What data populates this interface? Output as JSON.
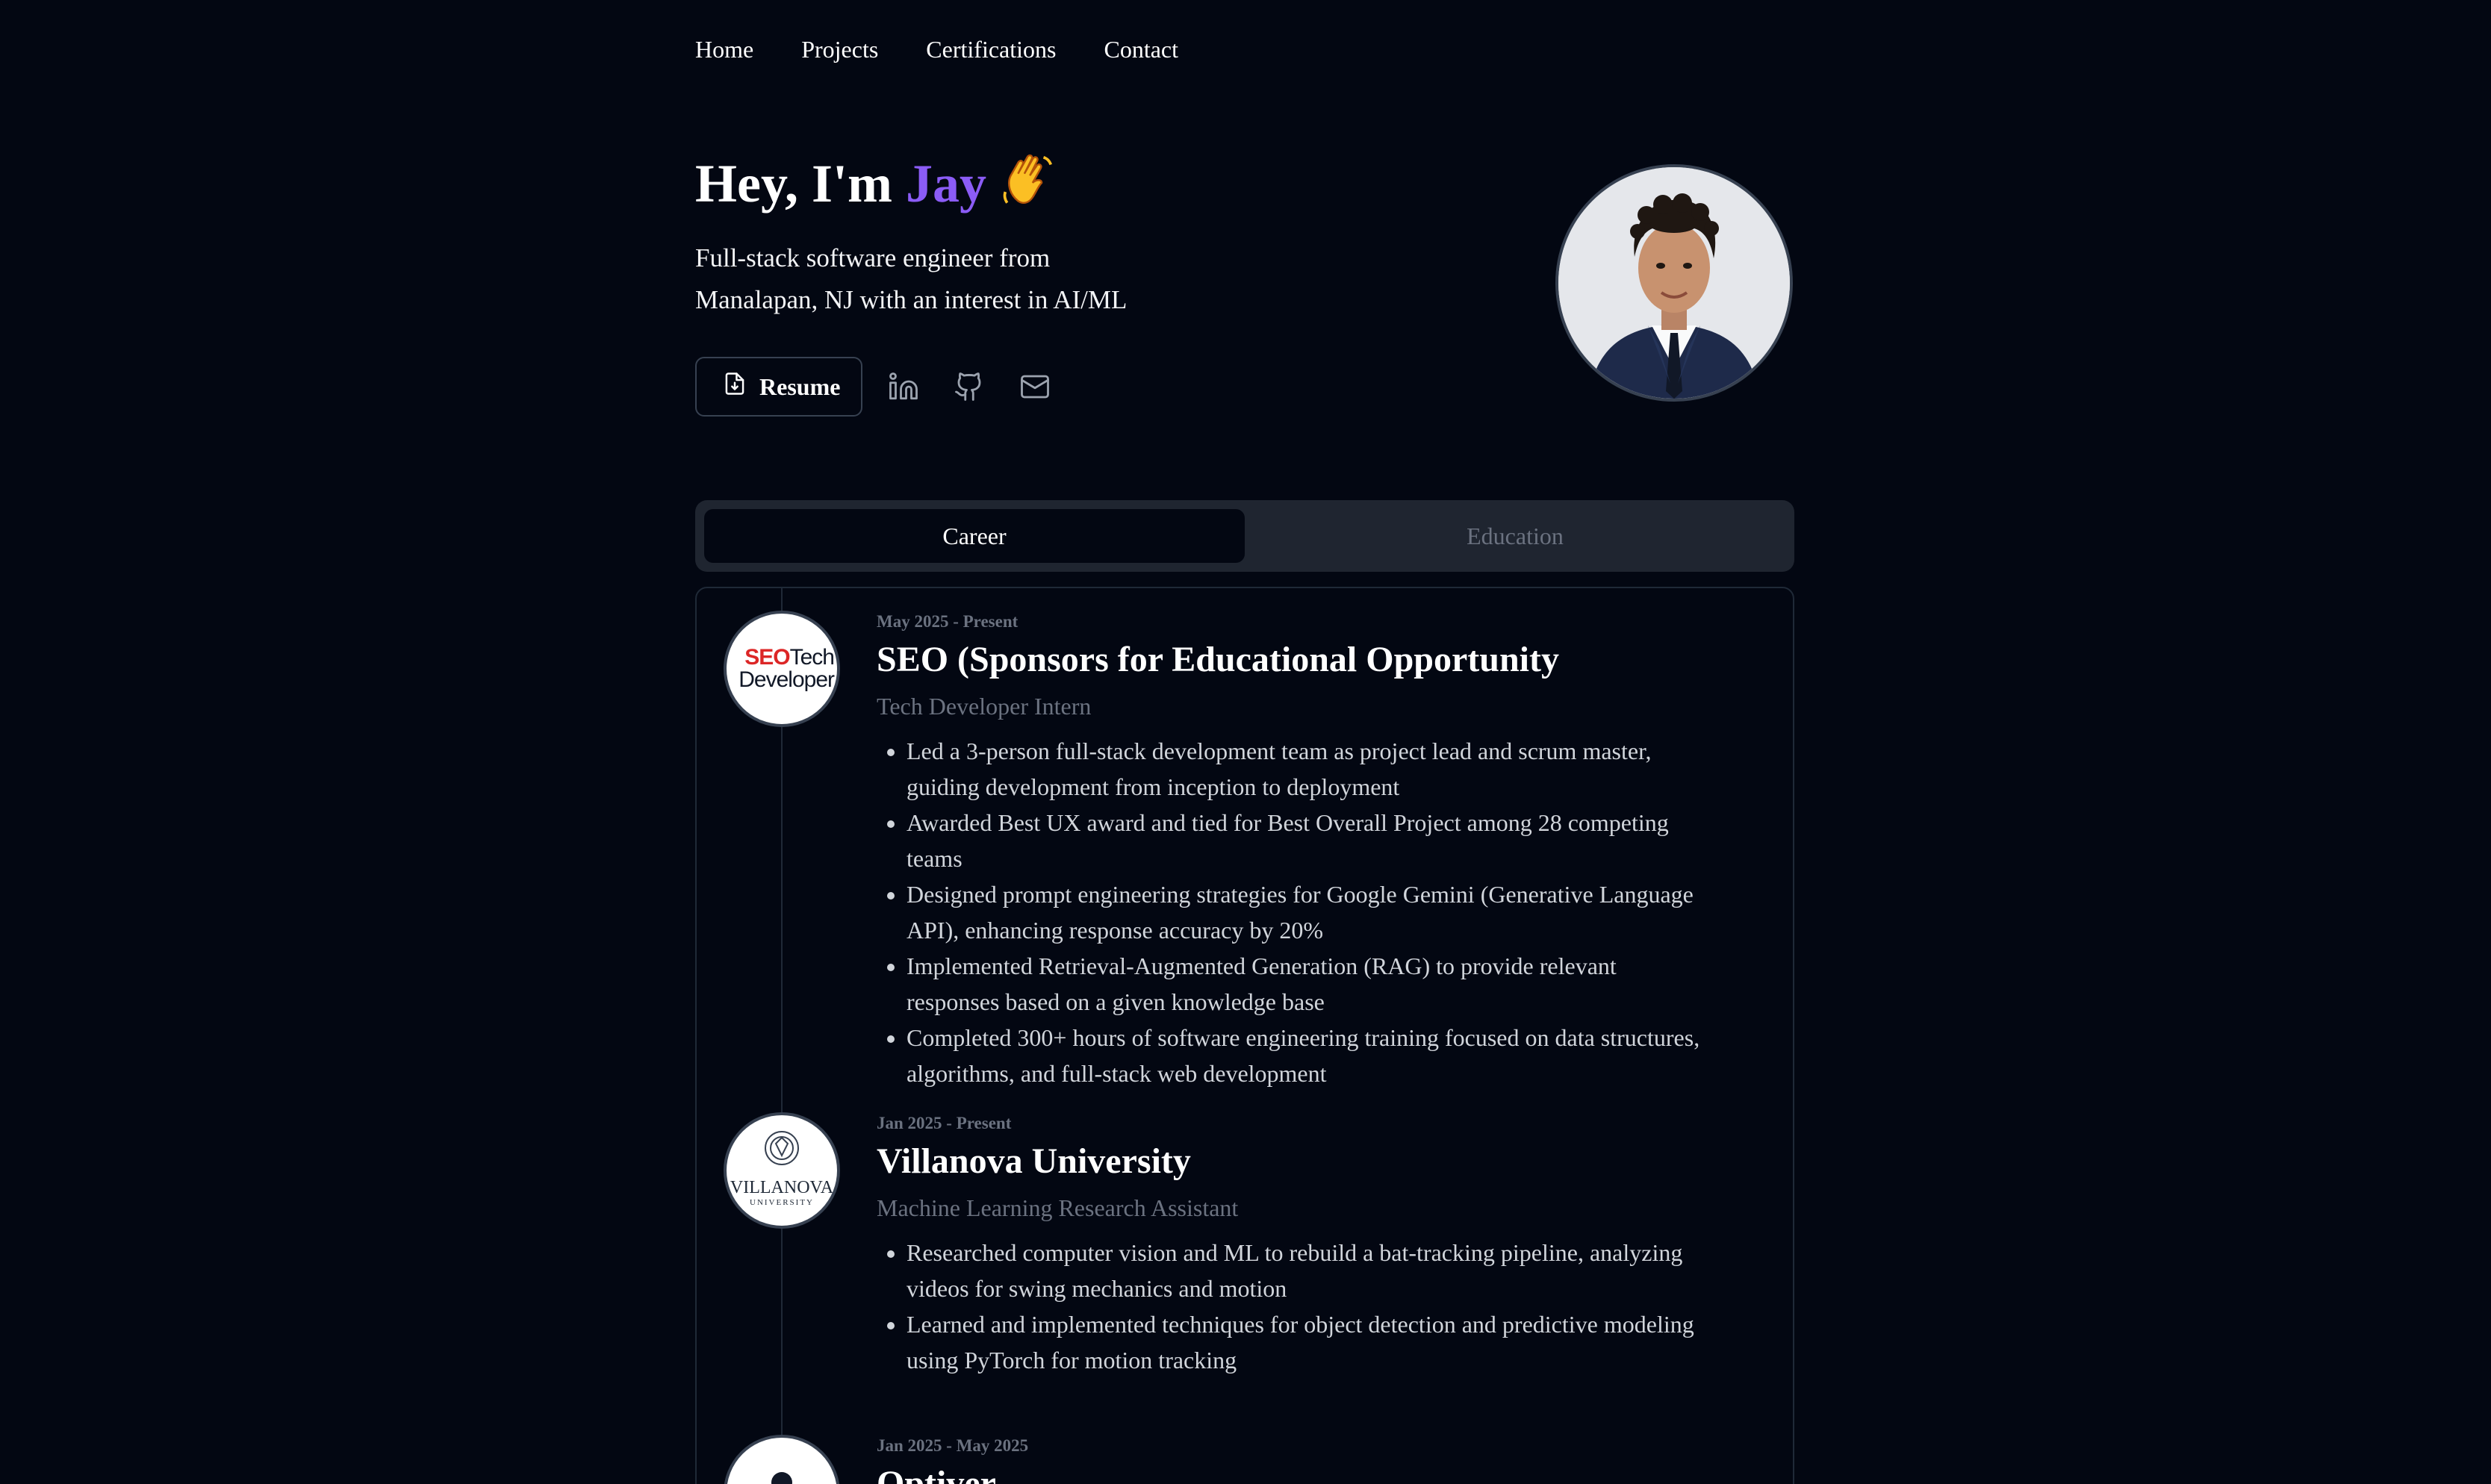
{
  "nav": {
    "home": "Home",
    "projects": "Projects",
    "certifications": "Certifications",
    "contact": "Contact"
  },
  "hero": {
    "greeting": "Hey, I'm ",
    "name": "Jay",
    "subtitle_line1": "Full-stack software engineer from",
    "subtitle_line2": "Manalapan, NJ with an interest in AI/ML",
    "resume_label": "Resume"
  },
  "social": [
    "linkedin-icon",
    "github-icon",
    "mail-icon"
  ],
  "tabs": {
    "career": "Career",
    "education": "Education",
    "active": "career"
  },
  "colors": {
    "background": "#030712",
    "accent": "#8b5cf6",
    "muted": "#6b7280",
    "border": "#1f2937"
  },
  "timeline": [
    {
      "date": "May 2025 - Present",
      "company": "SEO (Sponsors for Educational Opportunity",
      "role": "Tech Developer Intern",
      "logo": {
        "seo": "SEO",
        "tech": "Tech",
        "developer": "Developer"
      },
      "bullets": [
        "Led a 3-person full-stack development team as project lead and scrum master, guiding development from inception to deployment",
        "Awarded Best UX award and tied for Best Overall Project among 28 competing teams",
        "Designed prompt engineering strategies for Google Gemini (Generative Language API), enhancing response accuracy by 20%",
        "Implemented Retrieval-Augmented Generation (RAG) to provide relevant responses based on a given knowledge base",
        "Completed 300+ hours of software engineering training focused on data structures, algorithms, and full-stack web development"
      ]
    },
    {
      "date": "Jan 2025 - Present",
      "company": "Villanova University",
      "role": "Machine Learning Research Assistant",
      "logo": {
        "name": "VILLANOVA",
        "sub": "UNIVERSITY"
      },
      "bullets": [
        "Researched computer vision and ML to rebuild a bat-tracking pipeline, analyzing videos for swing mechanics and motion",
        "Learned and implemented techniques for object detection and predictive modeling using PyTorch for motion tracking"
      ]
    },
    {
      "date": "Jan 2025 - May 2025",
      "company": "Optiver",
      "role": "",
      "bullets": []
    }
  ]
}
